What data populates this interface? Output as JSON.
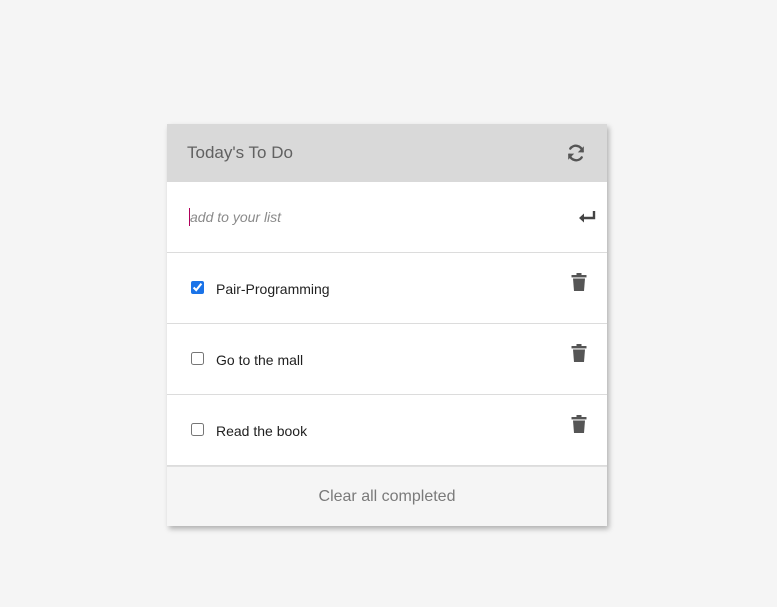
{
  "header": {
    "title": "Today's To Do",
    "refresh_icon": "refresh-icon"
  },
  "new_item": {
    "placeholder": "add to your list",
    "value": "",
    "submit_icon": "enter-arrow-icon"
  },
  "items": [
    {
      "label": "Pair-Programming",
      "checked": true,
      "delete_icon": "trash-icon"
    },
    {
      "label": "Go to the mall",
      "checked": false,
      "delete_icon": "trash-icon"
    },
    {
      "label": "Read the book",
      "checked": false,
      "delete_icon": "trash-icon"
    }
  ],
  "footer": {
    "clear_label": "Clear all completed"
  },
  "colors": {
    "header_bg": "#d9d9d9",
    "icon": "#555555",
    "checkbox_accent": "#1a73e8",
    "footer_bg": "#f5f5f5"
  }
}
